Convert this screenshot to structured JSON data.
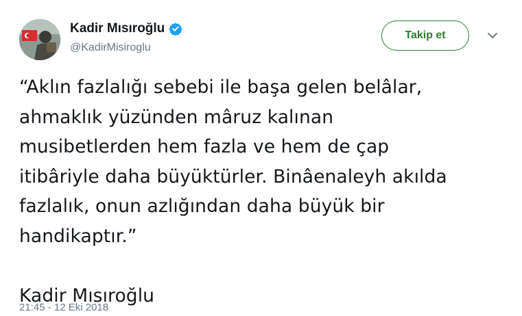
{
  "author": {
    "display_name": "Kadir Mısıroğlu",
    "handle": "@KadirMisiroglu",
    "verified_icon": "verified-badge-icon",
    "avatar_icon": "avatar-image"
  },
  "actions": {
    "follow_label": "Takip et",
    "menu_icon": "chevron-down-icon"
  },
  "tweet": {
    "lines": [
      "“Aklın fazlalığı sebebi ile başa gelen belâlar,",
      "ahmaklık yüzünden mâruz kalınan",
      "musibetlerden hem fazla ve hem de çap",
      "itibâriyle daha büyüktürler. Binâenaleyh akılda",
      "fazlalık, onun azlığından daha büyük bir",
      "handikaptır.”",
      "",
      "Kadir Mısıroğlu"
    ],
    "timestamp": "21:45 - 12 Eki 2018"
  },
  "colors": {
    "accent_green": "#2e7d32",
    "verified_blue": "#1da1f2",
    "muted_text": "#657786",
    "text": "#14171a"
  }
}
